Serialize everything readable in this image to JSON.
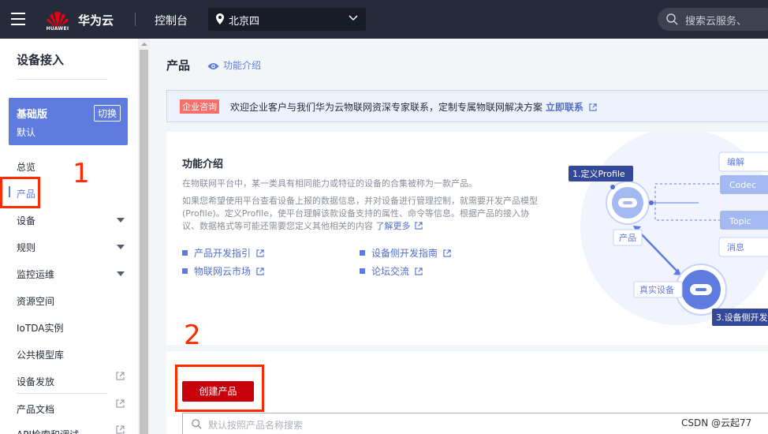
{
  "topbar": {
    "logo_text": "HUAWEI",
    "brand": "华为云",
    "console": "控制台",
    "region": "北京四",
    "search_placeholder": "搜索云服务、"
  },
  "sidebar": {
    "title": "设备接入",
    "edition": {
      "name": "基础版",
      "switch_label": "切换",
      "subtitle": "默认"
    },
    "items": [
      {
        "label": "总览"
      },
      {
        "label": "产品",
        "active": true
      },
      {
        "label": "设备",
        "expandable": true
      },
      {
        "label": "规则",
        "expandable": true
      },
      {
        "label": "监控运维",
        "expandable": true
      },
      {
        "label": "资源空间"
      },
      {
        "label": "IoTDA实例"
      },
      {
        "label": "公共模型库"
      },
      {
        "label": "设备发放",
        "external": true
      },
      {
        "label": "产品文档",
        "external": true
      },
      {
        "label": "API检索和调试",
        "external": true
      }
    ]
  },
  "main": {
    "title": "产品",
    "intro_link": "功能介绍",
    "banner": {
      "tag": "企业咨询",
      "text": "欢迎企业客户与我们华为云物联网资深专家联系，定制专属物联网解决方案",
      "link": "立即联系"
    },
    "card": {
      "title": "功能介绍",
      "para1": "在物联网平台中，某一类具有相同能力或特征的设备的合集被称为一款产品。",
      "para2": "如果您希望使用平台查看设备上报的数据信息，并对设备进行管理控制，就需要开发产品模型(Profile)。定义Profile，使平台理解该款设备支持的属性、命令等信息。根据产品的接入协议、数据格式等可能还需要您定义其他相关的内容",
      "para2_more": "了解更多",
      "links": [
        {
          "label": "产品开发指引"
        },
        {
          "label": "设备侧开发指南"
        },
        {
          "label": "物联网云市场"
        },
        {
          "label": "论坛交流"
        }
      ],
      "diagram": {
        "step1": "1.定义Profile",
        "step3": "3.设备侧开发",
        "product": "产品",
        "real_device": "真实设备",
        "codec": "Codec",
        "topic": "Topic",
        "edit": "编解",
        "message": "消息"
      }
    },
    "create_button": "创建产品",
    "list_search_placeholder": "默认按照产品名称搜索"
  },
  "annotations": {
    "num1": "1",
    "num2": "2"
  },
  "watermark": "CSDN @云起77",
  "colors": {
    "accent": "#5e7ce0",
    "brand_red": "#c7000b",
    "topbar": "#252b3a",
    "annotation": "#ff2a00"
  }
}
